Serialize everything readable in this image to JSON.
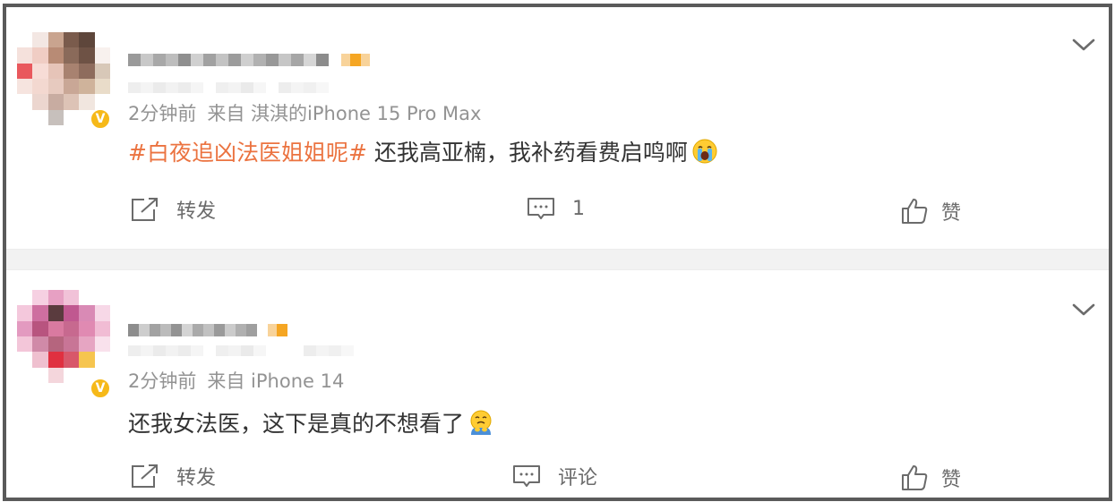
{
  "posts": [
    {
      "timestamp": "2分钟前",
      "source": "来自 淇淇的iPhone 15 Pro Max",
      "hashtag": "#白夜追凶法医姐姐呢#",
      "text": " 还我高亚楠，我补药看费启鸣啊",
      "emoji": "loudly-crying-face",
      "verified_badge": "V",
      "actions": {
        "repost": "转发",
        "comment": "1",
        "like": "赞"
      }
    },
    {
      "timestamp": "2分钟前",
      "source": "来自 iPhone 14",
      "hashtag": "",
      "text": "还我女法医，这下是真的不想看了",
      "emoji": "crying-face-with-hands",
      "verified_badge": "V",
      "actions": {
        "repost": "转发",
        "comment": "评论",
        "like": "赞"
      }
    }
  ],
  "colors": {
    "hashtag": "#eb7340",
    "meta_text": "#939393",
    "body_text": "#333333",
    "verified": "#f6b919",
    "frame_border": "#5a5a5a"
  }
}
